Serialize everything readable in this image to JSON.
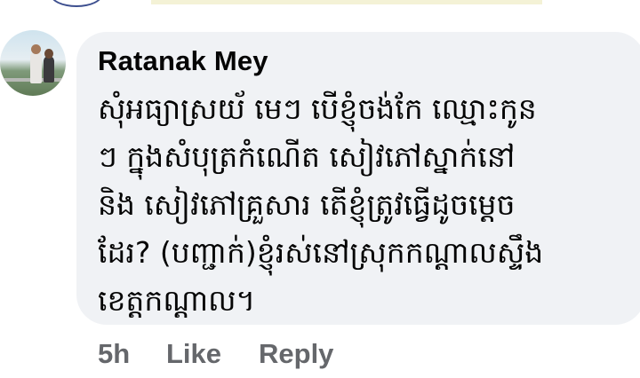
{
  "comment": {
    "author": "Ratanak Mey",
    "text_lines": [
      "សុំអធ្យាស្រយ័ មេៗ បើខ្ញុំចង់កែ ឈ្មោះកូន",
      "ៗ ក្នុងសំបុត្រកំណើត សៀវភៅស្នាក់នៅ",
      "និង សៀវភៅគ្រួសារ តើខ្ញុំត្រូវធ្វើដូចម្តេច",
      "ដែរ? (បញ្ជាក់)ខ្ញុំរស់នៅស្រុកកណ្ដាលស្ទឹង",
      "ខេត្តកណ្ដាល។"
    ],
    "time": "5h",
    "like_label": "Like",
    "reply_label": "Reply"
  },
  "colors": {
    "bubble_bg": "#f0f2f5",
    "text": "#050505",
    "secondary_text": "#65676b"
  }
}
